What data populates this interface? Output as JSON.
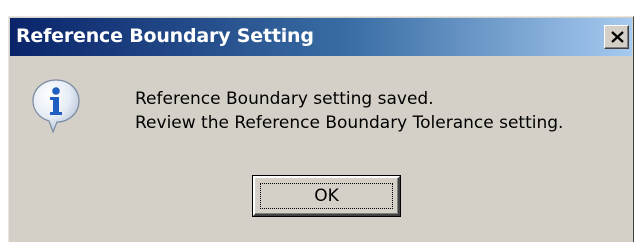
{
  "window": {
    "title": "Reference Boundary Setting",
    "close_icon": "close-icon"
  },
  "dialog": {
    "icon": "info-icon",
    "message_lines": [
      "Reference Boundary setting saved.",
      "Review the Reference Boundary Tolerance setting."
    ],
    "ok_label": "OK"
  },
  "colors": {
    "titlebar_start": "#0a246a",
    "titlebar_end": "#a6caf0",
    "dialog_bg": "#d4d0c8",
    "icon_blue": "#1f5fbf"
  }
}
